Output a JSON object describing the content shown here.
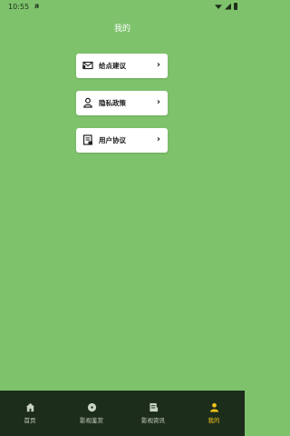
{
  "status": {
    "time": "10:55",
    "app_glyph": "ᴙ",
    "icons": [
      "wifi-icon",
      "signal-icon",
      "battery-icon"
    ]
  },
  "page": {
    "title": "我的"
  },
  "menu": [
    {
      "id": "feedback",
      "label": "给点建议",
      "icon": "mail-icon"
    },
    {
      "id": "privacy",
      "label": "隐私政策",
      "icon": "user-icon"
    },
    {
      "id": "agreement",
      "label": "用户协议",
      "icon": "document-icon"
    }
  ],
  "menu_chevron": "›",
  "tabs": [
    {
      "label": "首页",
      "icon": "home-icon",
      "active": false
    },
    {
      "label": "影视鉴赏",
      "icon": "film-icon",
      "active": false
    },
    {
      "label": "影视资讯",
      "icon": "news-icon",
      "active": false
    },
    {
      "label": "我的",
      "icon": "profile-icon",
      "active": true
    }
  ],
  "colors": {
    "background": "#7ec26c",
    "card": "#ffffff",
    "tabbar": "#1c2d1b",
    "tab_active": "#f2c21b",
    "tab_inactive": "#c9d4c5"
  }
}
